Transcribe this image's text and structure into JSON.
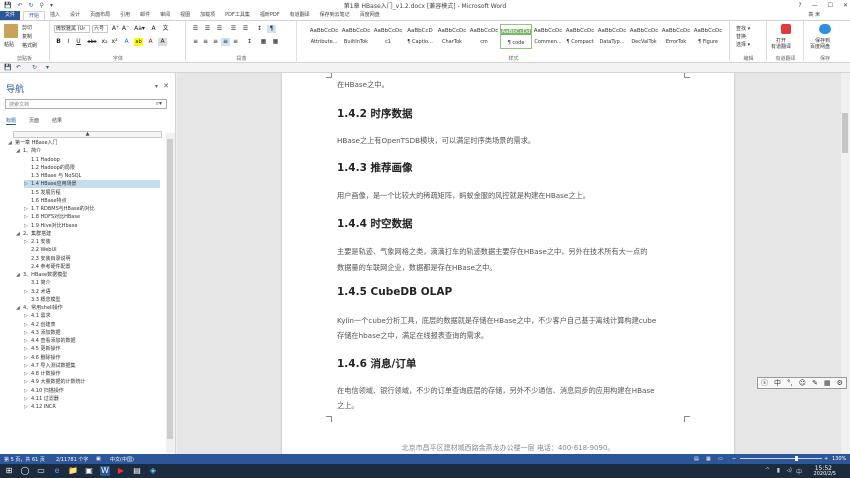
{
  "titlebar": {
    "title": "第1章 HBase入门_v1.2.docx [兼容模式] - Microsoft Word",
    "user": "高 米",
    "qat": [
      "💾",
      "↶",
      "↻",
      "⚲",
      "▾"
    ],
    "help": "?",
    "minimize": "—",
    "maximize": "☐",
    "close": "✕"
  },
  "tabs": [
    "文件",
    "开始",
    "插入",
    "设计",
    "页面布局",
    "引用",
    "邮件",
    "审阅",
    "视图",
    "加载项",
    "PDF工具集",
    "福昕PDF",
    "有道翻译",
    "保存到云笔记",
    "百度网盘"
  ],
  "ribbon": {
    "clipboard": {
      "paste": "粘贴",
      "cut": "剪切",
      "copy": "复制",
      "format_painter": "格式刷",
      "group": "剪贴板"
    },
    "font": {
      "name": "微软雅黑 (Ur",
      "size": "六号",
      "group": "字体",
      "row1_buttons": [
        "A⁺",
        "A⁻",
        "Aa▾",
        "A",
        "文"
      ],
      "row2_buttons": [
        "B",
        "I",
        "U",
        "abc",
        "x₂",
        "x²",
        "A",
        "ab",
        "A",
        "A"
      ]
    },
    "paragraph": {
      "group": "段落",
      "row1_buttons": [
        "☰",
        "☰",
        "☰",
        "☰",
        "☰",
        "↕",
        "¶"
      ],
      "row2_buttons": [
        "≡",
        "≡",
        "≡",
        "≡",
        "≡",
        "↕",
        "▦",
        "▦"
      ]
    },
    "styles": {
      "group": "样式",
      "items": [
        {
          "preview": "AaBbCcDc",
          "name": "Attribute..."
        },
        {
          "preview": "AaBbCcDc",
          "name": "BuiltInTok"
        },
        {
          "preview": "AaBbCcDc",
          "name": "c1"
        },
        {
          "preview": "AaBbCcD",
          "name": "¶ Captio..."
        },
        {
          "preview": "AaBbCcDc",
          "name": "CharTok"
        },
        {
          "preview": "AaBbCcDc",
          "name": "cm"
        },
        {
          "preview": "AaBbCcDd",
          "name": "¶ code"
        },
        {
          "preview": "AaBbCcDc",
          "name": "Commen..."
        },
        {
          "preview": "AaBbCcDc",
          "name": "¶ Compact"
        },
        {
          "preview": "AaBbCcDc",
          "name": "DataTyp..."
        },
        {
          "preview": "AaBbCcDc",
          "name": "DecValTok"
        },
        {
          "preview": "AaBbCcDc",
          "name": "ErrorTok"
        },
        {
          "preview": "AaBbCcDc",
          "name": "¶ Figure"
        }
      ]
    },
    "editing": {
      "find": "查找 ▾",
      "replace": "替换",
      "select": "选择 ▾",
      "group": "编辑"
    },
    "youdao": {
      "label1": "打开",
      "label2": "有道翻译",
      "group": "有道翻译"
    },
    "baidu": {
      "label1": "保存到",
      "label2": "百度网盘",
      "group": "保存"
    }
  },
  "nav": {
    "title": "导航",
    "search_placeholder": "搜索文档",
    "tabs": [
      "标题",
      "页面",
      "结果"
    ],
    "collapse": "▲",
    "items": [
      {
        "level": 0,
        "label": "第一章 HBase入门",
        "arrow": "◢"
      },
      {
        "level": 1,
        "label": "1、简介",
        "arrow": "◢"
      },
      {
        "level": 2,
        "label": "1.1 Hadoop",
        "arrow": ""
      },
      {
        "level": 2,
        "label": "1.2 Hadoop的局限",
        "arrow": ""
      },
      {
        "level": 2,
        "label": "1.3 HBase 与 NoSQL",
        "arrow": ""
      },
      {
        "level": 2,
        "label": "1.4 HBase应用场景",
        "arrow": "▷"
      },
      {
        "level": 2,
        "label": "1.5 发展历程",
        "arrow": ""
      },
      {
        "level": 2,
        "label": "1.6 HBase特点",
        "arrow": ""
      },
      {
        "level": 2,
        "label": "1.7 RDBMS与HBase的对比",
        "arrow": "▷"
      },
      {
        "level": 2,
        "label": "1.8 HDFS对比HBase",
        "arrow": "▷"
      },
      {
        "level": 2,
        "label": "1.9 Hive对比Hbase",
        "arrow": "▷"
      },
      {
        "level": 1,
        "label": "2、集群搭建",
        "arrow": "◢"
      },
      {
        "level": 2,
        "label": "2.1 安装",
        "arrow": "▷"
      },
      {
        "level": 2,
        "label": "2.2 WebUI",
        "arrow": ""
      },
      {
        "level": 2,
        "label": "2.3 安装目录说明",
        "arrow": ""
      },
      {
        "level": 2,
        "label": "2.4 参考硬件配置",
        "arrow": ""
      },
      {
        "level": 1,
        "label": "3、HBase数据模型",
        "arrow": "◢"
      },
      {
        "level": 2,
        "label": "3.1 简介",
        "arrow": ""
      },
      {
        "level": 2,
        "label": "3.2 术语",
        "arrow": "▷"
      },
      {
        "level": 2,
        "label": "3.3 概念模型",
        "arrow": ""
      },
      {
        "level": 1,
        "label": "4、常用shell操作",
        "arrow": "◢"
      },
      {
        "level": 2,
        "label": "4.1 需求",
        "arrow": "▷"
      },
      {
        "level": 2,
        "label": "4.2 创建表",
        "arrow": "▷"
      },
      {
        "level": 2,
        "label": "4.3 添加数据",
        "arrow": "▷"
      },
      {
        "level": 2,
        "label": "4.4 查看添加的数据",
        "arrow": "▷"
      },
      {
        "level": 2,
        "label": "4.5 更新操作",
        "arrow": "▷"
      },
      {
        "level": 2,
        "label": "4.6 删除操作",
        "arrow": "▷"
      },
      {
        "level": 2,
        "label": "4.7 导入测试数据集",
        "arrow": "▷"
      },
      {
        "level": 2,
        "label": "4.8 计数操作",
        "arrow": "▷"
      },
      {
        "level": 2,
        "label": "4.9 大量数据的计数统计",
        "arrow": "▷"
      },
      {
        "level": 2,
        "label": "4.10 扫描操作",
        "arrow": "▷"
      },
      {
        "level": 2,
        "label": "4.11 过滤器",
        "arrow": "▷"
      },
      {
        "level": 2,
        "label": "4.12 INCR",
        "arrow": "▷"
      }
    ]
  },
  "doc": {
    "blocks": [
      {
        "type": "text",
        "text": "在HBase之中。"
      },
      {
        "type": "heading",
        "text": "1.4.2  时序数据"
      },
      {
        "type": "text",
        "text": "HBase之上有OpenTSDB模块，可以满足时序类场景的需求。"
      },
      {
        "type": "heading",
        "text": "1.4.3  推荐画像"
      },
      {
        "type": "text",
        "text": "用户画像，是一个比较大的稀疏矩阵，蚂蚁金服的风控就是构建在HBase之上。"
      },
      {
        "type": "heading",
        "text": "1.4.4  时空数据"
      },
      {
        "type": "text",
        "text": "主要是轨迹、气象网格之类，滴滴打车的轨迹数据主要存在HBase之中，另外在技术所有大一点的"
      },
      {
        "type": "text",
        "text": "数据量的车联网企业，数据都是存在HBase之中。"
      },
      {
        "type": "heading",
        "text": "1.4.5  CubeDB OLAP"
      },
      {
        "type": "text",
        "text": "Kylin一个cube分析工具，底层的数据就是存储在HBase之中，不少客户自己基于离线计算构建cube"
      },
      {
        "type": "text",
        "text": "存储在hbase之中，满足在线报表查询的需求。"
      },
      {
        "type": "heading",
        "text": "1.4.6  消息/订单"
      },
      {
        "type": "text",
        "text": "在电信领域、银行领域，不少的订单查询底层的存储，另外不少通信、消息同步的应用构建在HBase"
      },
      {
        "type": "text",
        "text": "之上。"
      }
    ],
    "footer": "北京市昌平区建材城西路金燕龙办公楼一层      电话：400-618-9090。"
  },
  "ime": [
    "ⓢ",
    "中",
    "°,",
    "☺",
    "✎",
    "▦",
    "⚙"
  ],
  "status": {
    "page": "第 5 页，共 61 页",
    "words": "2/11781 个字",
    "lang": "中文(中国)",
    "zoom": "130%"
  },
  "taskbar": {
    "time": "15:52",
    "date": "2020/2/5",
    "icons": [
      "⊞",
      "◯",
      "▭",
      "e",
      "📁",
      "▣",
      "W",
      "▶",
      "▤",
      "◈"
    ],
    "tray": [
      "^",
      "▮",
      "◃)",
      "中"
    ]
  }
}
